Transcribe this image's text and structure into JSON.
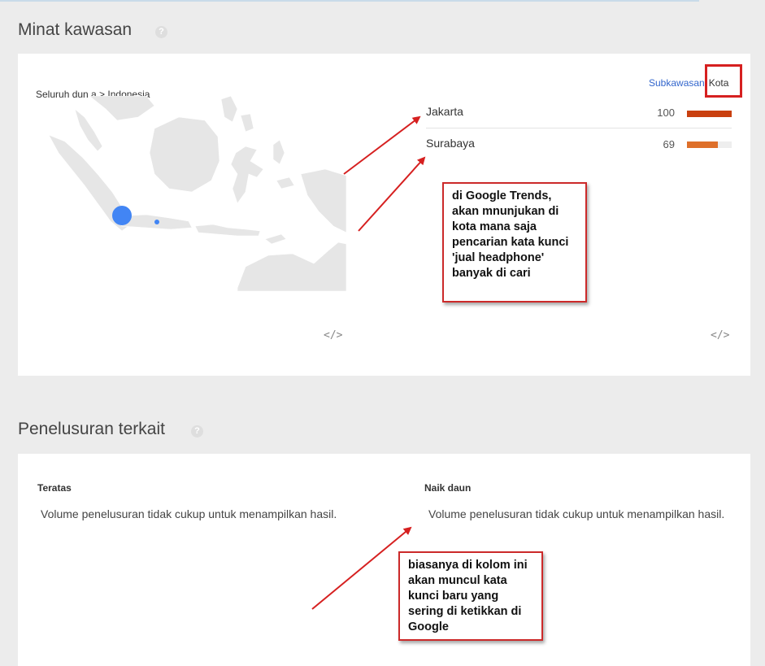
{
  "region": {
    "title": "Minat kawasan",
    "help": "?",
    "breadcrumb": "Seluruh dun a > Indonesia",
    "toggle": {
      "subregion": "Subkawasan",
      "city": "Kota"
    },
    "cities": [
      {
        "name": "Jakarta",
        "value": "100",
        "level": 100
      },
      {
        "name": "Surabaya",
        "value": "69",
        "level": 69
      }
    ],
    "bar_colors": [
      "#c9400f",
      "#de6f2a"
    ],
    "embed": "</>",
    "callout": "di Google Trends, akan mnunjukan di kota mana saja pencarian kata kunci 'jual headphone' banyak di cari"
  },
  "related": {
    "title": "Penelusuran terkait",
    "help": "?",
    "top_heading": "Teratas",
    "rising_heading": "Naik daun",
    "top_message": "Volume penelusuran tidak cukup untuk menampilkan hasil.",
    "rising_message": "Volume penelusuran tidak cukup untuk menampilkan hasil.",
    "callout": "biasanya di kolom ini akan muncul kata kunci baru yang sering di ketikkan di Google"
  },
  "colors": {
    "accent_red": "#d62020",
    "map_bubble": "#4285f4",
    "link": "#3366cc"
  }
}
